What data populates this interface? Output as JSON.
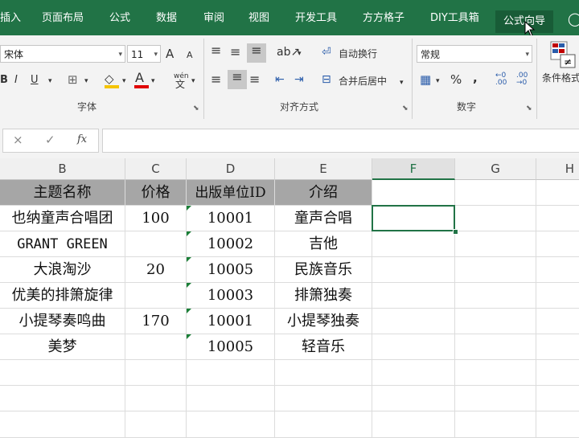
{
  "ribbon_tabs": [
    "插入",
    "页面布局",
    "公式",
    "数据",
    "审阅",
    "视图",
    "开发工具",
    "方方格子",
    "DIY工具箱",
    "公式向导"
  ],
  "font": {
    "name": "宋体",
    "size": "11",
    "grow": "A",
    "shrink": "A",
    "bold": "B",
    "italic": "I",
    "underline": "U",
    "font_color_glyph": "A",
    "wen": "wén",
    "wen2": "文",
    "group_label": "字体"
  },
  "alignment": {
    "wrap_label": "自动换行",
    "merge_label": "合并后居中",
    "group_label": "对齐方式"
  },
  "number": {
    "format": "常规",
    "percent": "%",
    "comma": ",",
    "group_label": "数字",
    "inc_decimal": "←0 .00",
    "dec_decimal": ".00 →0"
  },
  "styles": {
    "cond_format_label": "条件格式"
  },
  "formula_bar": {
    "cancel": "×",
    "confirm": "✓",
    "fx": "fx",
    "value": ""
  },
  "columns": [
    "B",
    "C",
    "D",
    "E",
    "F",
    "G",
    "H"
  ],
  "table": {
    "headers": [
      "主题名称",
      "价格",
      "出版单位ID",
      "介绍"
    ],
    "rows": [
      [
        "也纳童声合唱团",
        "100",
        "10001",
        "童声合唱"
      ],
      [
        "GRANT GREEN",
        "",
        "10002",
        "吉他"
      ],
      [
        "大浪淘沙",
        "20",
        "10005",
        "民族音乐"
      ],
      [
        "优美的排箫旋律",
        "",
        "10003",
        "排箫独奏"
      ],
      [
        "小提琴奏鸣曲",
        "170",
        "10001",
        "小提琴独奏"
      ],
      [
        "美梦",
        "",
        "10005",
        "轻音乐"
      ]
    ]
  },
  "colors": {
    "ribbon_green": "#217346",
    "header_fill": "#a6a6a6",
    "selection": "#217346"
  }
}
